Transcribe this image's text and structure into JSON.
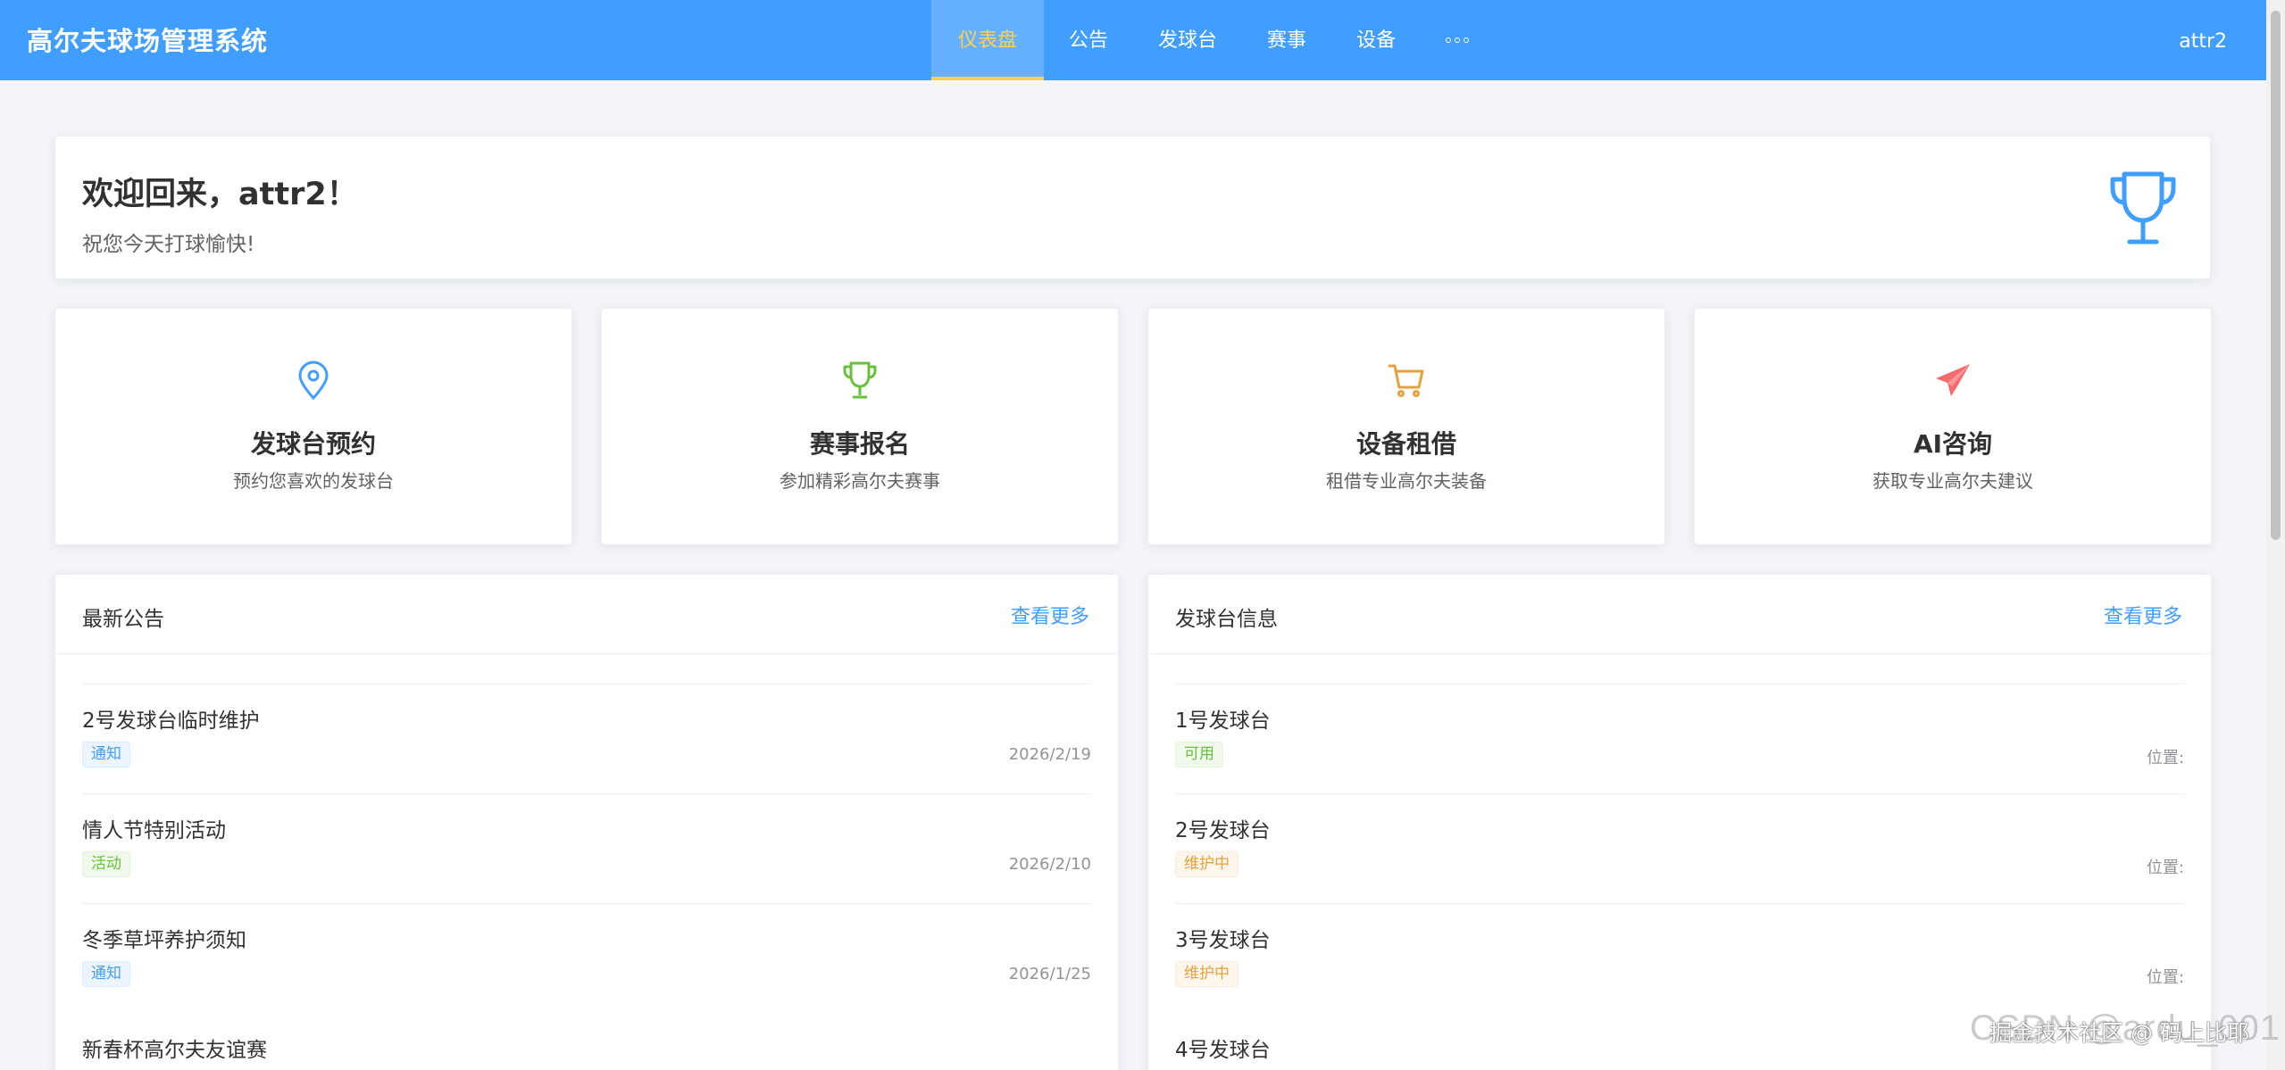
{
  "app": {
    "title": "高尔夫球场管理系统",
    "user": "attr2"
  },
  "nav": {
    "items": [
      {
        "label": "仪表盘",
        "active": true
      },
      {
        "label": "公告"
      },
      {
        "label": "发球台"
      },
      {
        "label": "赛事"
      },
      {
        "label": "设备"
      }
    ],
    "more_icon": "ellipsis-icon"
  },
  "welcome": {
    "title": "欢迎回来，attr2！",
    "subtitle": "祝您今天打球愉快!",
    "icon": "trophy-icon"
  },
  "quick_actions": [
    {
      "title": "发球台预约",
      "desc": "预约您喜欢的发球台",
      "icon": "location-pin-icon",
      "color": "#409eff"
    },
    {
      "title": "赛事报名",
      "desc": "参加精彩高尔夫赛事",
      "icon": "trophy-icon",
      "color": "#67c23a"
    },
    {
      "title": "设备租借",
      "desc": "租借专业高尔夫装备",
      "icon": "shopping-cart-icon",
      "color": "#e6a23c"
    },
    {
      "title": "AI咨询",
      "desc": "获取专业高尔夫建议",
      "icon": "paper-plane-icon",
      "color": "#f56c6c"
    }
  ],
  "announcements": {
    "title": "最新公告",
    "more": "查看更多",
    "items": [
      {
        "title": "2号发球台临时维护",
        "tag": "通知",
        "tag_color": "blue",
        "date": "2026/2/19"
      },
      {
        "title": "情人节特别活动",
        "tag": "活动",
        "tag_color": "green",
        "date": "2026/2/10"
      },
      {
        "title": "冬季草坪养护须知",
        "tag": "通知",
        "tag_color": "blue",
        "date": "2026/1/25"
      },
      {
        "title": "新春杯高尔夫友谊赛"
      }
    ]
  },
  "tees": {
    "title": "发球台信息",
    "more": "查看更多",
    "items": [
      {
        "title": "1号发球台",
        "status": "可用",
        "status_color": "green",
        "location": "位置:"
      },
      {
        "title": "2号发球台",
        "status": "维护中",
        "status_color": "orange",
        "location": "位置:"
      },
      {
        "title": "3号发球台",
        "status": "维护中",
        "status_color": "orange",
        "location": "位置:"
      },
      {
        "title": "4号发球台"
      }
    ]
  },
  "watermark": {
    "back": "CSDN @ardu_001",
    "front": "掘金技术社区 @ 码上比耶"
  }
}
